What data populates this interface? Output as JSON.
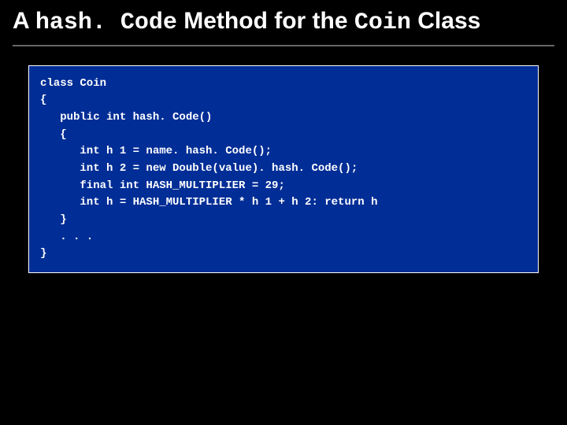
{
  "title": {
    "pre": "A ",
    "mono1": "hash. Code",
    "mid": " Method for the ",
    "mono2": "Coin",
    "post": " Class"
  },
  "code": "class Coin\n{\n   public int hash. Code()\n   {\n      int h 1 = name. hash. Code();\n      int h 2 = new Double(value). hash. Code();\n      final int HASH_MULTIPLIER = 29;\n      int h = HASH_MULTIPLIER * h 1 + h 2: return h\n   }\n   . . .\n}"
}
